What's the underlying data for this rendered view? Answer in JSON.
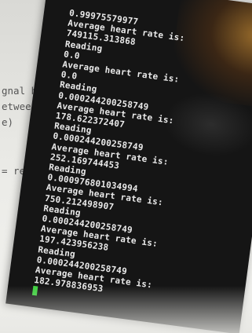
{
  "editor": {
    "lines": [
      "gnal has p",
      "etween su",
      "e)",
      "",
      "= refrac"
    ]
  },
  "terminal": {
    "lines": [
      "0.99975579977",
      "Average heart rate is:",
      "749115.313868",
      "Reading",
      "0.0",
      "Average heart rate is:",
      "0.0",
      "Reading",
      "0.000244200258749",
      "Average heart rate is:",
      "178.622372407",
      "Reading",
      "0.000244200258749",
      "Average heart rate is:",
      "252.169744453",
      "Reading",
      "0.000976801034994",
      "Average heart rate is:",
      "750.212498907",
      "Reading",
      "0.000244200258749",
      "Average heart rate is:",
      "197.423956238",
      "Reading",
      "0.000244200258749",
      "Average heart rate is:",
      "182.978836953"
    ]
  },
  "colors": {
    "terminal_bg": "#151515",
    "terminal_text": "#eaeaea",
    "cursor": "#3ecf3e"
  }
}
